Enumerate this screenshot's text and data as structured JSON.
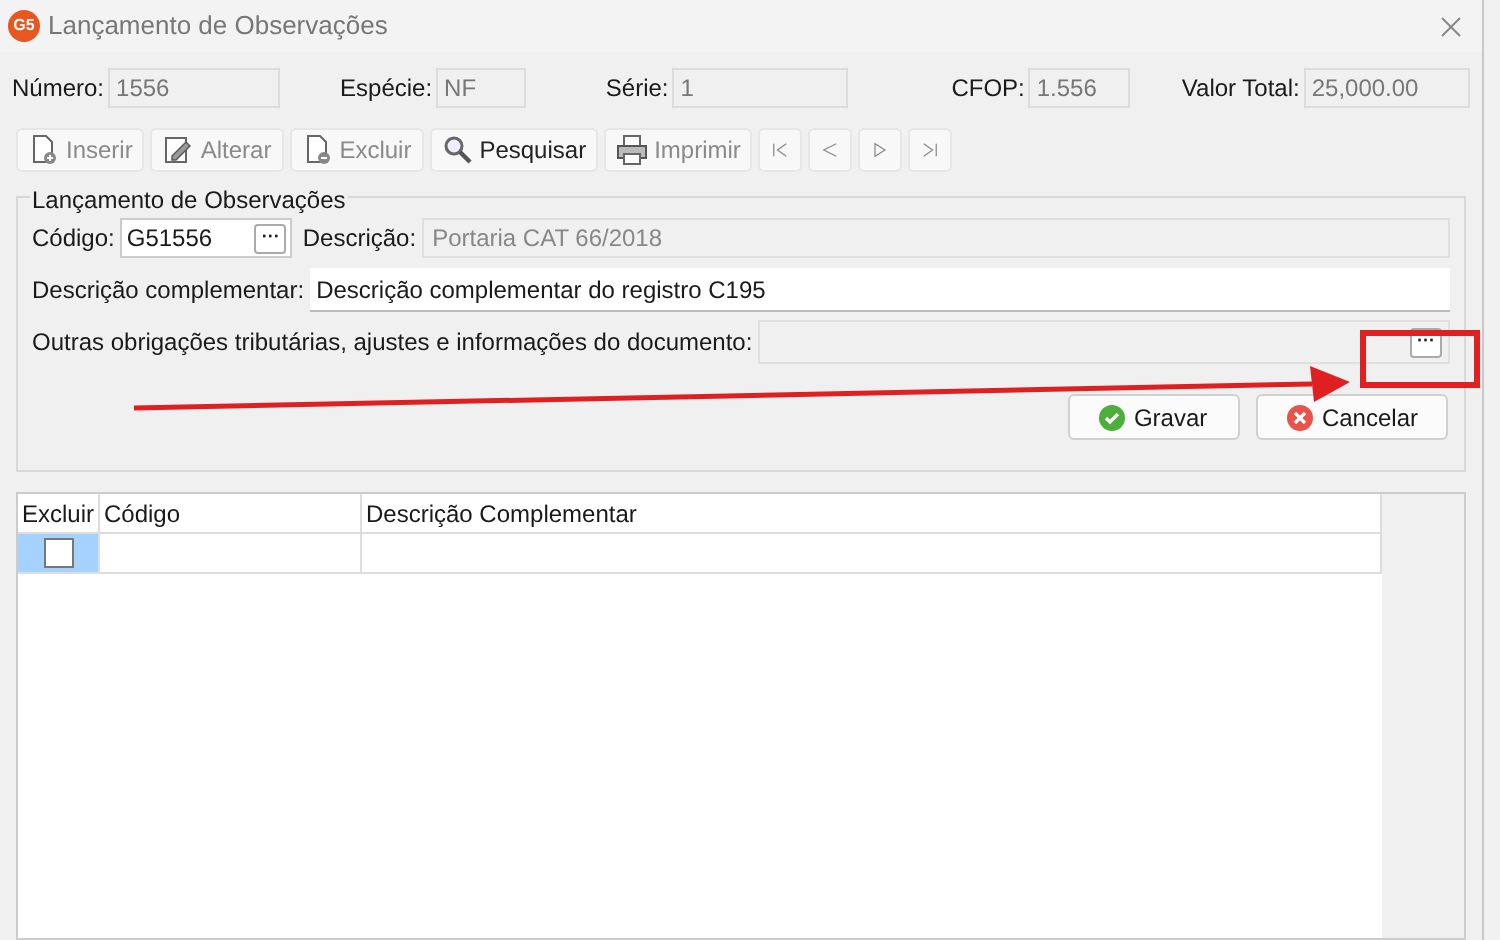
{
  "window": {
    "title": "Lançamento de Observações",
    "logo": "G5"
  },
  "header_fields": [
    {
      "label": "Número:",
      "value": "1556"
    },
    {
      "label": "Espécie:",
      "value": "NF"
    },
    {
      "label": "Série:",
      "value": "1"
    },
    {
      "label": "CFOP:",
      "value": "1.556"
    },
    {
      "label": "Valor Total:",
      "value": "25,000.00"
    }
  ],
  "toolbar": [
    {
      "kind": "text",
      "label": "Inserir",
      "disabled": true
    },
    {
      "kind": "text",
      "label": "Alterar",
      "disabled": true
    },
    {
      "kind": "text",
      "label": "Excluir",
      "disabled": true
    },
    {
      "kind": "text",
      "label": "Pesquisar",
      "disabled": false
    },
    {
      "kind": "text",
      "label": "Imprimir",
      "disabled": true
    },
    {
      "kind": "nav",
      "disabled": true
    },
    {
      "kind": "nav",
      "disabled": true
    },
    {
      "kind": "nav",
      "disabled": true
    },
    {
      "kind": "nav",
      "disabled": true
    }
  ],
  "group": {
    "title": "Lançamento de Observações",
    "codigo": {
      "label": "Código:",
      "value": "G51556",
      "button": "···"
    },
    "descricao": {
      "label": "Descrição:",
      "value": "Portaria CAT 66/2018"
    },
    "complementar": {
      "label": "Descrição complementar:",
      "value": "Descrição complementar do registro C195"
    },
    "outras": {
      "label": "Outras obrigações tributárias, ajustes e informações do documento:",
      "button": "···"
    },
    "buttons": [
      {
        "kind": "save",
        "label": "Gravar"
      },
      {
        "kind": "cancel",
        "label": "Cancelar"
      }
    ]
  },
  "table": {
    "columns": [
      "Excluir",
      "Código",
      "Descrição Complementar"
    ],
    "rows": [
      {
        "checked": false,
        "selected": true
      }
    ]
  }
}
